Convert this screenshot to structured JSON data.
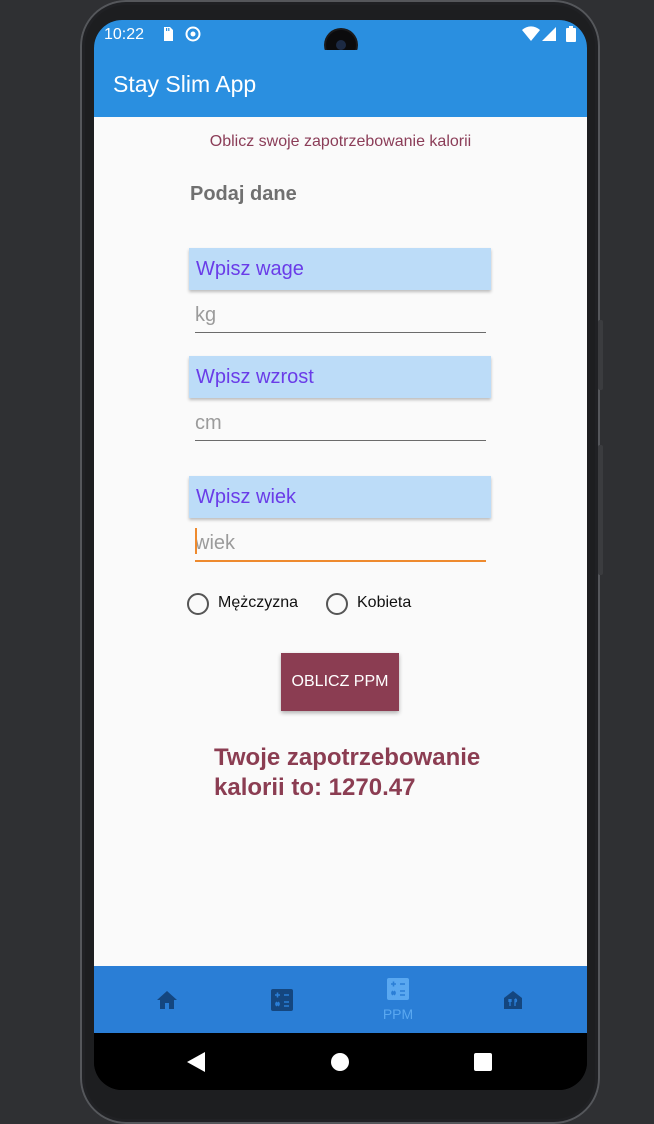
{
  "status_bar": {
    "time": "10:22"
  },
  "app_bar": {
    "title": "Stay Slim App"
  },
  "main": {
    "subtitle": "Oblicz swoje zapotrzebowanie kalorii",
    "section_title": "Podaj dane",
    "weight": {
      "label": "Wpisz wage",
      "placeholder": "kg"
    },
    "height": {
      "label": "Wpisz wzrost",
      "placeholder": "cm"
    },
    "age": {
      "label": "Wpisz wiek",
      "placeholder": "wiek"
    },
    "gender_options": [
      "Mężczyzna",
      "Kobieta"
    ],
    "button_label": "OBLICZ PPM",
    "result_text": "Twoje zapotrzebowanie kalorii to: 1270.47"
  },
  "bottom_nav": {
    "items": [
      {
        "icon": "home-icon",
        "label": ""
      },
      {
        "icon": "calculator-icon",
        "label": ""
      },
      {
        "icon": "calculator-icon",
        "label": "PPM",
        "active": true
      },
      {
        "icon": "restaurant-icon",
        "label": ""
      }
    ]
  },
  "colors": {
    "primary": "#2a8fe0",
    "nav_bar": "#2a7ed6",
    "accent": "#8b3d52",
    "label_bg": "#bcdcf8",
    "label_text": "#6a3ce8",
    "focus": "#ee8a2e"
  }
}
